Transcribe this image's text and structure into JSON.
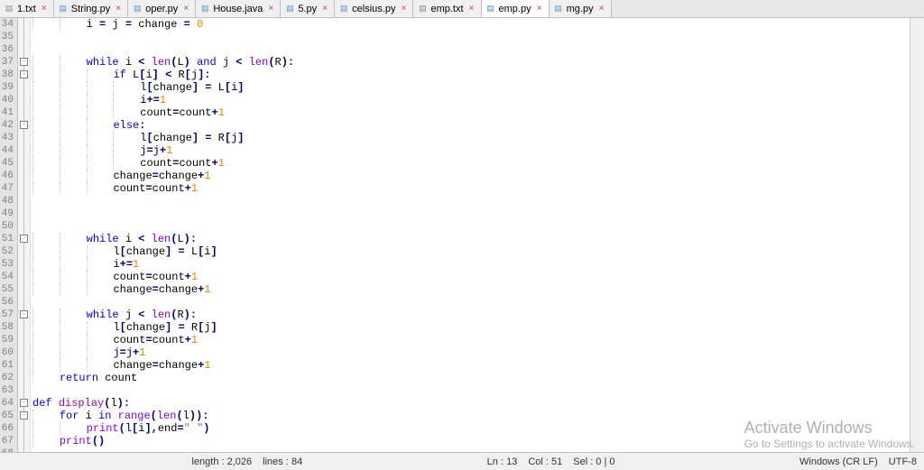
{
  "tabs": [
    {
      "name": "1.txt",
      "icon": "txt",
      "active": false
    },
    {
      "name": "String.py",
      "icon": "py",
      "active": false
    },
    {
      "name": "oper.py",
      "icon": "py",
      "active": false
    },
    {
      "name": "House.java",
      "icon": "java",
      "active": false
    },
    {
      "name": "5.py",
      "icon": "py",
      "active": false
    },
    {
      "name": "celsius.py",
      "icon": "py",
      "active": false
    },
    {
      "name": "emp.txt",
      "icon": "txt",
      "active": false
    },
    {
      "name": "emp.py",
      "icon": "py",
      "active": true
    },
    {
      "name": "mg.py",
      "icon": "py",
      "active": false
    }
  ],
  "lineStart": 34,
  "code": [
    {
      "indent": 2,
      "tokens": [
        {
          "t": "text",
          "v": "i "
        },
        {
          "t": "op",
          "v": "="
        },
        {
          "t": "text",
          "v": " j "
        },
        {
          "t": "op",
          "v": "="
        },
        {
          "t": "text",
          "v": " change "
        },
        {
          "t": "op",
          "v": "="
        },
        {
          "t": "text",
          "v": " "
        },
        {
          "t": "num",
          "v": "0"
        }
      ]
    },
    {
      "indent": 0,
      "tokens": []
    },
    {
      "indent": 0,
      "tokens": []
    },
    {
      "indent": 2,
      "tokens": [
        {
          "t": "kw",
          "v": "while"
        },
        {
          "t": "text",
          "v": " i "
        },
        {
          "t": "op",
          "v": "<"
        },
        {
          "t": "text",
          "v": " "
        },
        {
          "t": "builtin",
          "v": "len"
        },
        {
          "t": "op",
          "v": "("
        },
        {
          "t": "text",
          "v": "L"
        },
        {
          "t": "op",
          "v": ")"
        },
        {
          "t": "text",
          "v": " "
        },
        {
          "t": "kw",
          "v": "and"
        },
        {
          "t": "text",
          "v": " j "
        },
        {
          "t": "op",
          "v": "<"
        },
        {
          "t": "text",
          "v": " "
        },
        {
          "t": "builtin",
          "v": "len"
        },
        {
          "t": "op",
          "v": "("
        },
        {
          "t": "text",
          "v": "R"
        },
        {
          "t": "op",
          "v": "):"
        }
      ]
    },
    {
      "indent": 3,
      "tokens": [
        {
          "t": "kw",
          "v": "if"
        },
        {
          "t": "text",
          "v": " L"
        },
        {
          "t": "op",
          "v": "["
        },
        {
          "t": "text",
          "v": "i"
        },
        {
          "t": "op",
          "v": "]"
        },
        {
          "t": "text",
          "v": " "
        },
        {
          "t": "op",
          "v": "<"
        },
        {
          "t": "text",
          "v": " R"
        },
        {
          "t": "op",
          "v": "["
        },
        {
          "t": "text",
          "v": "j"
        },
        {
          "t": "op",
          "v": "]:"
        }
      ]
    },
    {
      "indent": 4,
      "tokens": [
        {
          "t": "text",
          "v": "l"
        },
        {
          "t": "op",
          "v": "["
        },
        {
          "t": "text",
          "v": "change"
        },
        {
          "t": "op",
          "v": "]"
        },
        {
          "t": "text",
          "v": " "
        },
        {
          "t": "op",
          "v": "="
        },
        {
          "t": "text",
          "v": " L"
        },
        {
          "t": "op",
          "v": "["
        },
        {
          "t": "text",
          "v": "i"
        },
        {
          "t": "op",
          "v": "]"
        }
      ]
    },
    {
      "indent": 4,
      "tokens": [
        {
          "t": "text",
          "v": "i"
        },
        {
          "t": "op",
          "v": "+="
        },
        {
          "t": "num",
          "v": "1"
        }
      ]
    },
    {
      "indent": 4,
      "tokens": [
        {
          "t": "text",
          "v": "count"
        },
        {
          "t": "op",
          "v": "="
        },
        {
          "t": "text",
          "v": "count"
        },
        {
          "t": "op",
          "v": "+"
        },
        {
          "t": "num",
          "v": "1"
        }
      ]
    },
    {
      "indent": 3,
      "tokens": [
        {
          "t": "kw",
          "v": "else"
        },
        {
          "t": "op",
          "v": ":"
        }
      ]
    },
    {
      "indent": 4,
      "tokens": [
        {
          "t": "text",
          "v": "l"
        },
        {
          "t": "op",
          "v": "["
        },
        {
          "t": "text",
          "v": "change"
        },
        {
          "t": "op",
          "v": "]"
        },
        {
          "t": "text",
          "v": " "
        },
        {
          "t": "op",
          "v": "="
        },
        {
          "t": "text",
          "v": " R"
        },
        {
          "t": "op",
          "v": "["
        },
        {
          "t": "text",
          "v": "j"
        },
        {
          "t": "op",
          "v": "]"
        }
      ]
    },
    {
      "indent": 4,
      "tokens": [
        {
          "t": "text",
          "v": "j"
        },
        {
          "t": "op",
          "v": "="
        },
        {
          "t": "text",
          "v": "j"
        },
        {
          "t": "op",
          "v": "+"
        },
        {
          "t": "num",
          "v": "1"
        }
      ]
    },
    {
      "indent": 4,
      "tokens": [
        {
          "t": "text",
          "v": "count"
        },
        {
          "t": "op",
          "v": "="
        },
        {
          "t": "text",
          "v": "count"
        },
        {
          "t": "op",
          "v": "+"
        },
        {
          "t": "num",
          "v": "1"
        }
      ]
    },
    {
      "indent": 3,
      "tokens": [
        {
          "t": "text",
          "v": "change"
        },
        {
          "t": "op",
          "v": "="
        },
        {
          "t": "text",
          "v": "change"
        },
        {
          "t": "op",
          "v": "+"
        },
        {
          "t": "num",
          "v": "1"
        }
      ]
    },
    {
      "indent": 3,
      "tokens": [
        {
          "t": "text",
          "v": "count"
        },
        {
          "t": "op",
          "v": "="
        },
        {
          "t": "text",
          "v": "count"
        },
        {
          "t": "op",
          "v": "+"
        },
        {
          "t": "num",
          "v": "1"
        }
      ]
    },
    {
      "indent": 0,
      "tokens": []
    },
    {
      "indent": 0,
      "tokens": []
    },
    {
      "indent": 0,
      "tokens": []
    },
    {
      "indent": 2,
      "tokens": [
        {
          "t": "kw",
          "v": "while"
        },
        {
          "t": "text",
          "v": " i "
        },
        {
          "t": "op",
          "v": "<"
        },
        {
          "t": "text",
          "v": " "
        },
        {
          "t": "builtin",
          "v": "len"
        },
        {
          "t": "op",
          "v": "("
        },
        {
          "t": "text",
          "v": "L"
        },
        {
          "t": "op",
          "v": "):"
        }
      ]
    },
    {
      "indent": 3,
      "tokens": [
        {
          "t": "text",
          "v": "l"
        },
        {
          "t": "op",
          "v": "["
        },
        {
          "t": "text",
          "v": "change"
        },
        {
          "t": "op",
          "v": "]"
        },
        {
          "t": "text",
          "v": " "
        },
        {
          "t": "op",
          "v": "="
        },
        {
          "t": "text",
          "v": " L"
        },
        {
          "t": "op",
          "v": "["
        },
        {
          "t": "text",
          "v": "i"
        },
        {
          "t": "op",
          "v": "]"
        }
      ]
    },
    {
      "indent": 3,
      "tokens": [
        {
          "t": "text",
          "v": "i"
        },
        {
          "t": "op",
          "v": "+="
        },
        {
          "t": "num",
          "v": "1"
        }
      ]
    },
    {
      "indent": 3,
      "tokens": [
        {
          "t": "text",
          "v": "count"
        },
        {
          "t": "op",
          "v": "="
        },
        {
          "t": "text",
          "v": "count"
        },
        {
          "t": "op",
          "v": "+"
        },
        {
          "t": "num",
          "v": "1"
        }
      ]
    },
    {
      "indent": 3,
      "tokens": [
        {
          "t": "text",
          "v": "change"
        },
        {
          "t": "op",
          "v": "="
        },
        {
          "t": "text",
          "v": "change"
        },
        {
          "t": "op",
          "v": "+"
        },
        {
          "t": "num",
          "v": "1"
        }
      ]
    },
    {
      "indent": 0,
      "tokens": []
    },
    {
      "indent": 2,
      "tokens": [
        {
          "t": "kw",
          "v": "while"
        },
        {
          "t": "text",
          "v": " j "
        },
        {
          "t": "op",
          "v": "<"
        },
        {
          "t": "text",
          "v": " "
        },
        {
          "t": "builtin",
          "v": "len"
        },
        {
          "t": "op",
          "v": "("
        },
        {
          "t": "text",
          "v": "R"
        },
        {
          "t": "op",
          "v": "):"
        }
      ]
    },
    {
      "indent": 3,
      "tokens": [
        {
          "t": "text",
          "v": "l"
        },
        {
          "t": "op",
          "v": "["
        },
        {
          "t": "text",
          "v": "change"
        },
        {
          "t": "op",
          "v": "]"
        },
        {
          "t": "text",
          "v": " "
        },
        {
          "t": "op",
          "v": "="
        },
        {
          "t": "text",
          "v": " R"
        },
        {
          "t": "op",
          "v": "["
        },
        {
          "t": "text",
          "v": "j"
        },
        {
          "t": "op",
          "v": "]"
        }
      ]
    },
    {
      "indent": 3,
      "tokens": [
        {
          "t": "text",
          "v": "count"
        },
        {
          "t": "op",
          "v": "="
        },
        {
          "t": "text",
          "v": "count"
        },
        {
          "t": "op",
          "v": "+"
        },
        {
          "t": "num",
          "v": "1"
        }
      ]
    },
    {
      "indent": 3,
      "tokens": [
        {
          "t": "text",
          "v": "j"
        },
        {
          "t": "op",
          "v": "="
        },
        {
          "t": "text",
          "v": "j"
        },
        {
          "t": "op",
          "v": "+"
        },
        {
          "t": "num",
          "v": "1"
        }
      ]
    },
    {
      "indent": 3,
      "tokens": [
        {
          "t": "text",
          "v": "change"
        },
        {
          "t": "op",
          "v": "="
        },
        {
          "t": "text",
          "v": "change"
        },
        {
          "t": "op",
          "v": "+"
        },
        {
          "t": "num",
          "v": "1"
        }
      ]
    },
    {
      "indent": 1,
      "tokens": [
        {
          "t": "kw",
          "v": "return"
        },
        {
          "t": "text",
          "v": " count"
        }
      ]
    },
    {
      "indent": 0,
      "tokens": []
    },
    {
      "indent": 0,
      "tokens": [
        {
          "t": "kw",
          "v": "def"
        },
        {
          "t": "text",
          "v": " "
        },
        {
          "t": "defname",
          "v": "display"
        },
        {
          "t": "op",
          "v": "("
        },
        {
          "t": "text",
          "v": "l"
        },
        {
          "t": "op",
          "v": "):"
        }
      ]
    },
    {
      "indent": 1,
      "tokens": [
        {
          "t": "kw",
          "v": "for"
        },
        {
          "t": "text",
          "v": " i "
        },
        {
          "t": "kw",
          "v": "in"
        },
        {
          "t": "text",
          "v": " "
        },
        {
          "t": "builtin",
          "v": "range"
        },
        {
          "t": "op",
          "v": "("
        },
        {
          "t": "builtin",
          "v": "len"
        },
        {
          "t": "op",
          "v": "("
        },
        {
          "t": "text",
          "v": "l"
        },
        {
          "t": "op",
          "v": ")):"
        }
      ]
    },
    {
      "indent": 2,
      "tokens": [
        {
          "t": "builtin",
          "v": "print"
        },
        {
          "t": "op",
          "v": "("
        },
        {
          "t": "text",
          "v": "l"
        },
        {
          "t": "op",
          "v": "["
        },
        {
          "t": "text",
          "v": "i"
        },
        {
          "t": "op",
          "v": "],"
        },
        {
          "t": "text",
          "v": "end"
        },
        {
          "t": "op",
          "v": "="
        },
        {
          "t": "str",
          "v": "\" \""
        },
        {
          "t": "op",
          "v": ")"
        }
      ]
    },
    {
      "indent": 1,
      "tokens": [
        {
          "t": "builtin",
          "v": "print"
        },
        {
          "t": "op",
          "v": "()"
        }
      ]
    },
    {
      "indent": 0,
      "tokens": []
    }
  ],
  "foldBoxes": [
    3,
    4,
    8,
    17,
    23,
    30,
    31
  ],
  "status": {
    "left": "",
    "length": "length : 2,026",
    "lines": "lines : 84",
    "ln": "Ln : 13",
    "col": "Col : 51",
    "sel": "Sel : 0 | 0",
    "eol": "Windows (CR LF)",
    "enc": "UTF-8"
  },
  "watermark": {
    "line1": "Activate Windows",
    "line2": "Go to Settings to activate Windows."
  }
}
